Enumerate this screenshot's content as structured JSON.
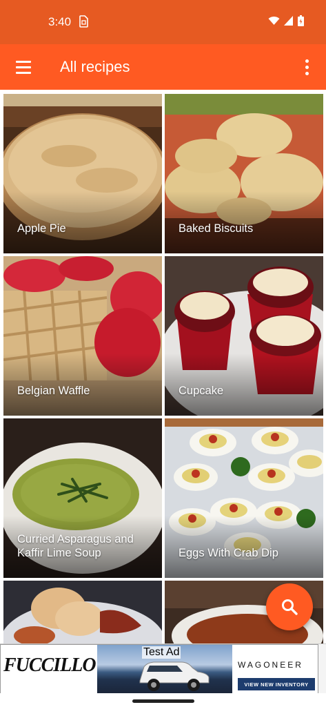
{
  "status_bar": {
    "time": "3:40",
    "icons": [
      "sim-icon",
      "wifi-icon",
      "signal-icon",
      "battery-icon"
    ]
  },
  "app_bar": {
    "title": "All recipes",
    "menu_icon": "hamburger-menu-icon",
    "overflow_icon": "more-vert-icon"
  },
  "recipes": [
    {
      "name": "Apple Pie"
    },
    {
      "name": "Baked Biscuits"
    },
    {
      "name": "Belgian Waffle"
    },
    {
      "name": "Cupcake"
    },
    {
      "name": "Curried Asparagus and Kaffir Lime Soup"
    },
    {
      "name": "Eggs With Crab Dip"
    },
    {
      "name": ""
    },
    {
      "name": ""
    }
  ],
  "fab": {
    "icon": "search-icon"
  },
  "ad": {
    "label": "Test Ad",
    "brand": "FUCCILLO",
    "product": "WAGONEER",
    "cta": "VIEW NEW INVENTORY"
  },
  "colors": {
    "status_bar": "#e65a22",
    "primary": "#ff5a22"
  }
}
